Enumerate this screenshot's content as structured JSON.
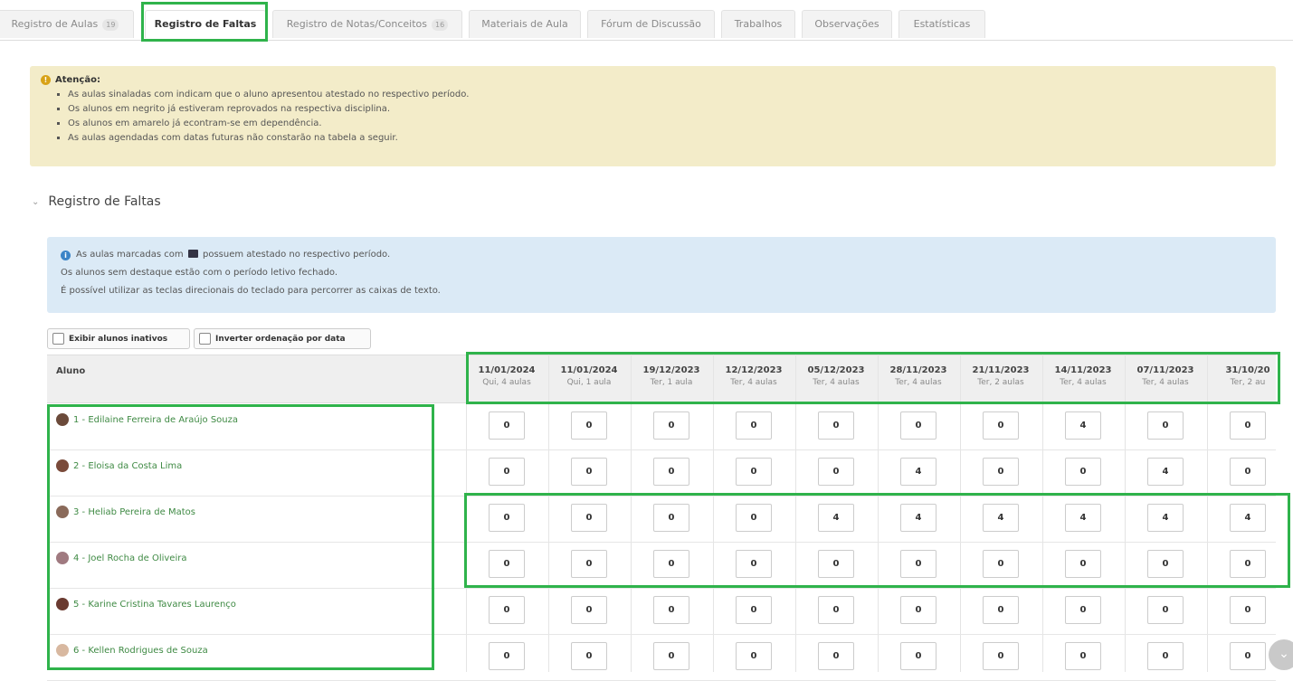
{
  "tabs": [
    {
      "label": "Registro de Aulas",
      "badge": "19"
    },
    {
      "label": "Registro de Faltas",
      "badge": ""
    },
    {
      "label": "Registro de Notas/Conceitos",
      "badge": "16"
    },
    {
      "label": "Materiais de Aula",
      "badge": ""
    },
    {
      "label": "Fórum de Discussão",
      "badge": ""
    },
    {
      "label": "Trabalhos",
      "badge": ""
    },
    {
      "label": "Observações",
      "badge": ""
    },
    {
      "label": "Estatísticas",
      "badge": ""
    }
  ],
  "warning": {
    "title": "Atenção:",
    "items": [
      "As aulas sinaladas com indicam que o aluno apresentou atestado no respectivo período.",
      "Os alunos em negrito já estiveram reprovados na respectiva disciplina.",
      "Os alunos em amarelo já econtram-se em dependência.",
      "As aulas agendadas com datas futuras não constarão na tabela a seguir."
    ]
  },
  "section_title": "Registro de Faltas",
  "info": {
    "line1_pre": "As aulas marcadas com",
    "line1_post": "possuem atestado no respectivo período.",
    "line2": "Os alunos sem destaque estão com o período letivo fechado.",
    "line3": "É possível utilizar as teclas direcionais do teclado para percorrer as caixas de texto."
  },
  "controls": {
    "show_inactive": "Exibir alunos inativos",
    "invert_order": "Inverter ordenação por data"
  },
  "table": {
    "student_header": "Aluno",
    "columns": [
      {
        "date": "11/01/2024",
        "sub": "Qui, 4 aulas"
      },
      {
        "date": "11/01/2024",
        "sub": "Qui, 1 aula"
      },
      {
        "date": "19/12/2023",
        "sub": "Ter, 1 aula"
      },
      {
        "date": "12/12/2023",
        "sub": "Ter, 4 aulas"
      },
      {
        "date": "05/12/2023",
        "sub": "Ter, 4 aulas"
      },
      {
        "date": "28/11/2023",
        "sub": "Ter, 4 aulas"
      },
      {
        "date": "21/11/2023",
        "sub": "Ter, 2 aulas"
      },
      {
        "date": "14/11/2023",
        "sub": "Ter, 4 aulas"
      },
      {
        "date": "07/11/2023",
        "sub": "Ter, 4 aulas"
      },
      {
        "date": "31/10/20",
        "sub": "Ter, 2 au"
      }
    ],
    "rows": [
      {
        "student": "1 - Edilaine Ferreira de Araújo Souza",
        "avatar_color": "#6b4a3a",
        "values": [
          "0",
          "0",
          "0",
          "0",
          "0",
          "0",
          "0",
          "4",
          "0",
          "0"
        ]
      },
      {
        "student": "2 - Eloisa da Costa Lima",
        "avatar_color": "#7a4a3a",
        "values": [
          "0",
          "0",
          "0",
          "0",
          "0",
          "4",
          "0",
          "0",
          "4",
          "0"
        ]
      },
      {
        "student": "3 - Heliab Pereira de Matos",
        "avatar_color": "#8a6a5a",
        "values": [
          "0",
          "0",
          "0",
          "0",
          "4",
          "4",
          "4",
          "4",
          "4",
          "4"
        ]
      },
      {
        "student": "4 - Joel Rocha de Oliveira",
        "avatar_color": "#a07a80",
        "values": [
          "0",
          "0",
          "0",
          "0",
          "0",
          "0",
          "0",
          "0",
          "0",
          "0"
        ]
      },
      {
        "student": "5 - Karine Cristina Tavares Laurenço",
        "avatar_color": "#6a3a30",
        "values": [
          "0",
          "0",
          "0",
          "0",
          "0",
          "0",
          "0",
          "0",
          "0",
          "0"
        ]
      },
      {
        "student": "6 - Kellen Rodrigues de Souza",
        "avatar_color": "#d8b8a0",
        "values": [
          "0",
          "0",
          "0",
          "0",
          "0",
          "0",
          "0",
          "0",
          "0",
          "0"
        ]
      }
    ]
  },
  "icons": {
    "warning": "warning-circle-icon",
    "info": "info-circle-icon",
    "collapse": "chevron-down-icon",
    "scroll": "chevron-down-icon"
  }
}
